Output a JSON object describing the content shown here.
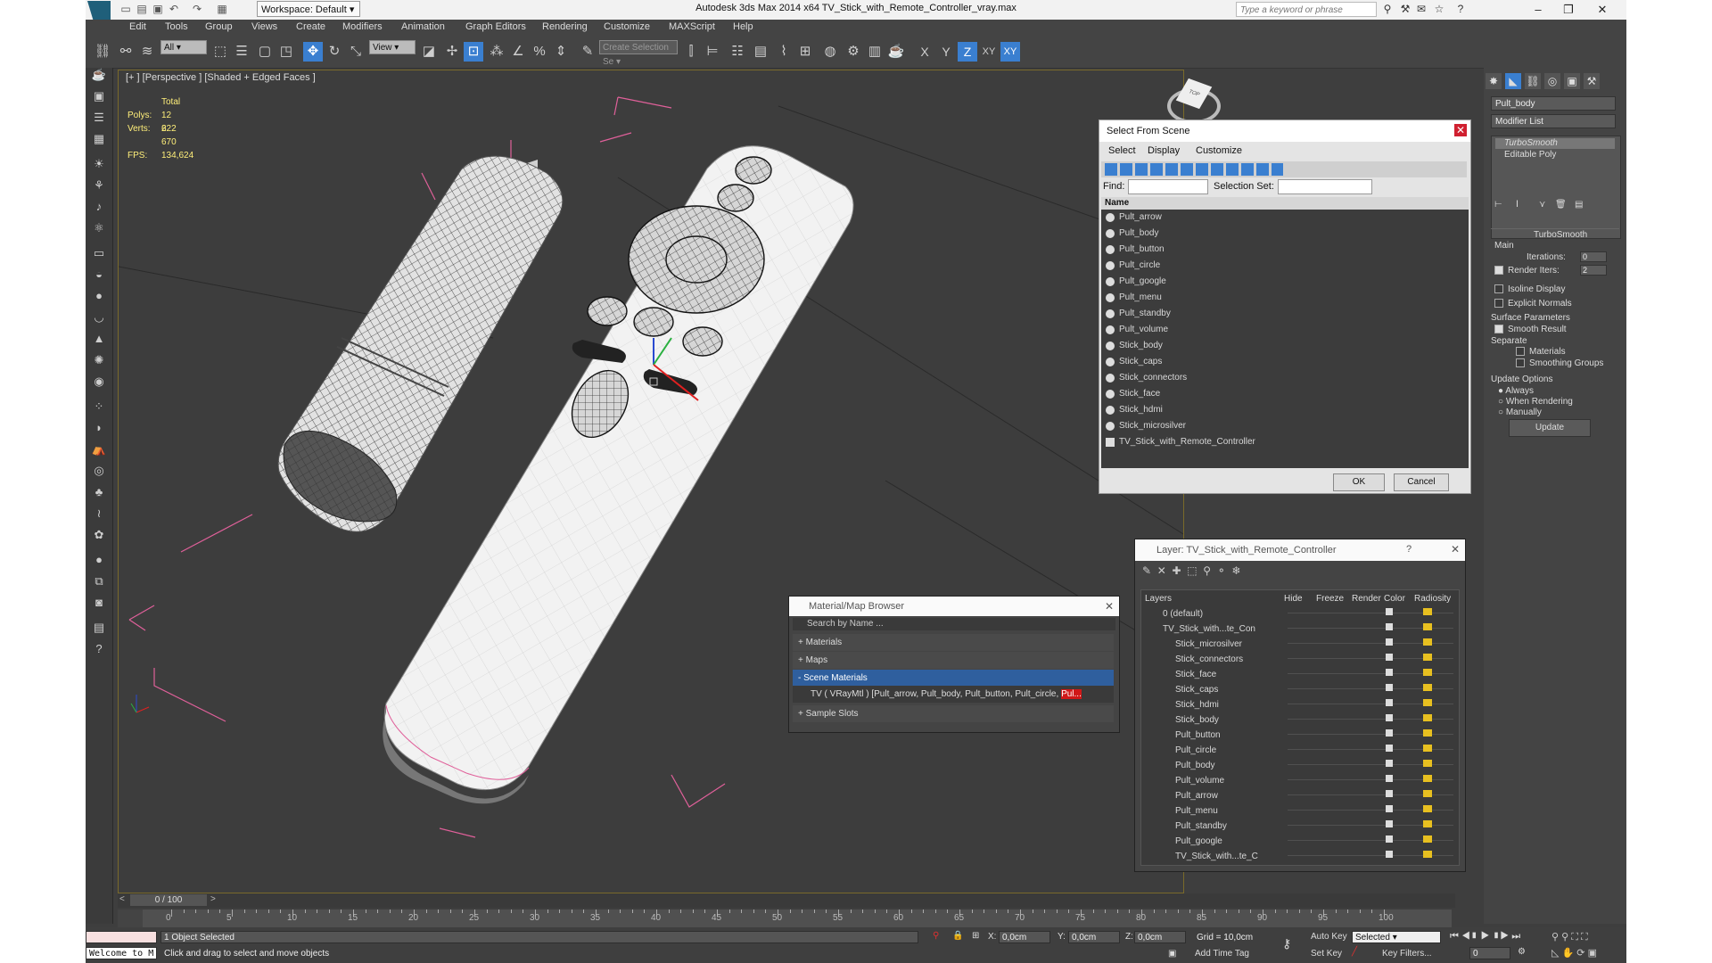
{
  "window": {
    "title": "Autodesk 3ds Max  2014 x64     TV_Stick_with_Remote_Controller_vray.max",
    "workspace": "Workspace: Default",
    "search_placeholder": "Type a keyword or phrase"
  },
  "menu": [
    "Edit",
    "Tools",
    "Group",
    "Views",
    "Create",
    "Modifiers",
    "Animation",
    "Graph Editors",
    "Rendering",
    "Customize",
    "MAXScript",
    "Help"
  ],
  "toolbar": {
    "selection_filter": "All",
    "ref_coord": "View",
    "named_selection_placeholder": "Create Selection Se",
    "axis_labels": [
      "X",
      "Y",
      "Z",
      "XY",
      "XY"
    ]
  },
  "viewport": {
    "label": "[+ ] [Perspective ] [Shaded + Edged Faces ]",
    "stats": {
      "total_label": "Total",
      "polys_label": "Polys:",
      "polys_value": "12 222",
      "verts_label": "Verts:",
      "verts_value": "6 670",
      "fps_label": "FPS:",
      "fps_value": "134,624"
    }
  },
  "select_from_scene": {
    "title": "Select From Scene",
    "menus": [
      "Select",
      "Display",
      "Customize"
    ],
    "find_label": "Find:",
    "selection_set_label": "Selection Set:",
    "column_name": "Name",
    "items": [
      "Pult_arrow",
      "Pult_body",
      "Pult_button",
      "Pult_circle",
      "Pult_google",
      "Pult_menu",
      "Pult_standby",
      "Pult_volume",
      "Stick_body",
      "Stick_caps",
      "Stick_connectors",
      "Stick_face",
      "Stick_hdmi",
      "Stick_microsilver",
      "TV_Stick_with_Remote_Controller"
    ],
    "ok": "OK",
    "cancel": "Cancel"
  },
  "layer_dialog": {
    "title": "Layer: TV_Stick_with_Remote_Controller",
    "help": "?",
    "columns": [
      "Layers",
      "Hide",
      "Freeze",
      "Render",
      "Color",
      "Radiosity"
    ],
    "rows": [
      "0 (default)",
      "TV_Stick_with...te_Con",
      "Stick_microsilver",
      "Stick_connectors",
      "Stick_face",
      "Stick_caps",
      "Stick_hdmi",
      "Stick_body",
      "Pult_button",
      "Pult_circle",
      "Pult_body",
      "Pult_volume",
      "Pult_arrow",
      "Pult_menu",
      "Pult_standby",
      "Pult_google",
      "TV_Stick_with...te_C"
    ]
  },
  "material_browser": {
    "title": "Material/Map Browser",
    "search_placeholder": "Search by Name ...",
    "groups": [
      "+ Materials",
      "+ Maps",
      "- Scene Materials",
      "+ Sample Slots"
    ],
    "scene_material_prefix": "TV  ( VRayMtl ) ",
    "scene_material_list": "[Pult_arrow, Pult_body, Pult_button, Pult_circle, ",
    "scene_material_highlight": "Pul..."
  },
  "command_panel": {
    "object_name": "Pult_body",
    "modifier_list": "Modifier List",
    "stack": [
      "TurboSmooth",
      "Editable Poly"
    ],
    "rollout": "TurboSmooth",
    "main_label": "Main",
    "iterations_label": "Iterations:",
    "iterations_value": "0",
    "render_iters_label": "Render Iters:",
    "render_iters_value": "2",
    "isoline": "Isoline Display",
    "explicit_normals": "Explicit Normals",
    "surface_params": "Surface Parameters",
    "smooth_result": "Smooth Result",
    "separate": "Separate",
    "materials": "Materials",
    "smoothing_groups": "Smoothing Groups",
    "update_options": "Update Options",
    "always": "Always",
    "when_rendering": "When Rendering",
    "manually": "Manually",
    "update_button": "Update"
  },
  "timeline": {
    "frame": "0 / 100",
    "ticks": [
      "0",
      "5",
      "10",
      "15",
      "20",
      "25",
      "30",
      "35",
      "40",
      "45",
      "50",
      "55",
      "60",
      "65",
      "70",
      "75",
      "80",
      "85",
      "90",
      "95",
      "100"
    ]
  },
  "status": {
    "welcome": "Welcome to M",
    "selected": "1 Object Selected",
    "prompt": "Click and drag to select and move objects",
    "x_label": "X:",
    "x_value": "0,0cm",
    "y_label": "Y:",
    "y_value": "0,0cm",
    "z_label": "Z:",
    "z_value": "0,0cm",
    "grid": "Grid = 10,0cm",
    "auto_key": "Auto Key",
    "selected_dropdown": "Selected",
    "set_key": "Set Key",
    "key_filters": "Key Filters...",
    "add_time_tag": "Add Time Tag",
    "frame_field": "0"
  },
  "colors": {
    "accent": "#3a7fd0",
    "ui_bg": "#444444",
    "viewport_bg": "#3d3d3d",
    "stats_text": "#ffef7a",
    "selection_red": "#e02020"
  }
}
